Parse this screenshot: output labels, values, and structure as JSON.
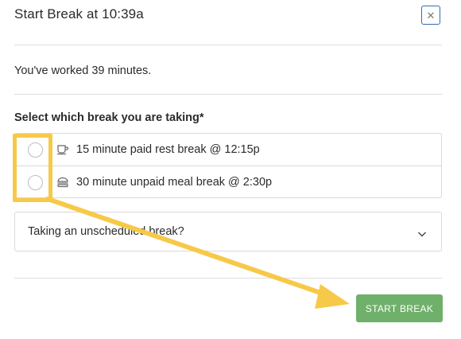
{
  "modal": {
    "title": "Start Break at 10:39a",
    "close_icon": "close-icon"
  },
  "summary": {
    "worked_text": "You've worked 39 minutes."
  },
  "break_selection": {
    "label": "Select which break you are taking*",
    "options": [
      {
        "icon": "coffee-cup-icon",
        "label": "15 minute paid rest break @ 12:15p",
        "selected": false
      },
      {
        "icon": "burger-icon",
        "label": "30 minute unpaid meal break @ 2:30p",
        "selected": false
      }
    ]
  },
  "unscheduled": {
    "label": "Taking an unscheduled break?",
    "icon": "chevron-down-icon"
  },
  "actions": {
    "start_label": "START BREAK"
  },
  "annotation": {
    "highlight_color": "#f7c948",
    "arrow_color": "#f7c948"
  },
  "colors": {
    "primary_button": "#6fb06a",
    "close_border": "#2f6db3"
  }
}
